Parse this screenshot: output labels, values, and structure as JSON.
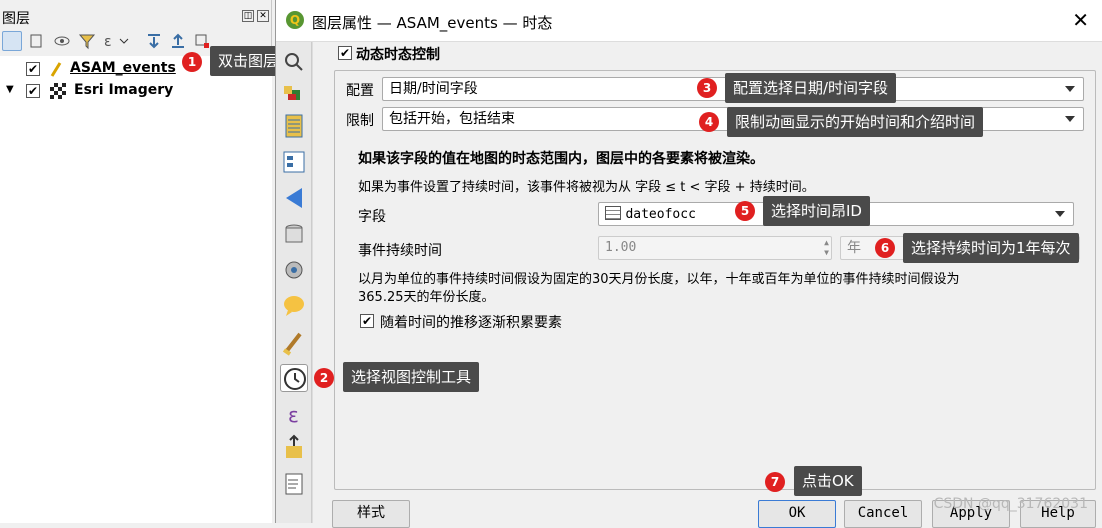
{
  "layers_panel": {
    "title": "图层",
    "layers": [
      {
        "name": "ASAM_events",
        "checked": true
      },
      {
        "name": "Esri Imagery",
        "checked": true
      }
    ]
  },
  "dialog": {
    "title": "图层属性 — ASAM_events — 时态",
    "enable_label": "动态时态控制",
    "config_label": "配置",
    "config_value": "日期/时间字段",
    "limit_label": "限制",
    "limit_value": "包括开始，包括结束",
    "info_bold": "如果该字段的值在地图的时态范围内，图层中的各要素将被渲染。",
    "info_text": "如果为事件设置了持续时间，该事件将被视为从 字段 ≤ t < 字段 + 持续时间。",
    "field_label": "字段",
    "field_value": "dateofocc",
    "duration_label": "事件持续时间",
    "duration_value": "1.00",
    "duration_unit": "年",
    "note_line1": "以月为单位的事件持续时间假设为固定的30天月份长度，以年，十年或百年为单位的事件持续时间假设为",
    "note_line2": "365.25天的年份长度。",
    "accumulate_label": "随着时间的推移逐渐积累要素",
    "style_button": "样式",
    "ok_button": "OK",
    "cancel_button": "Cancel",
    "apply_button": "Apply",
    "help_button": "Help"
  },
  "annotations": [
    {
      "n": "1",
      "text": "双击图层打开图层属性"
    },
    {
      "n": "2",
      "text": "选择视图控制工具"
    },
    {
      "n": "3",
      "text": "配置选择日期/时间字段"
    },
    {
      "n": "4",
      "text": "限制动画显示的开始时间和介绍时间"
    },
    {
      "n": "5",
      "text": "选择时间昂ID"
    },
    {
      "n": "6",
      "text": "选择持续时间为1年每次"
    },
    {
      "n": "7",
      "text": "点击OK"
    }
  ],
  "watermark": "CSDN @qq_31762031",
  "colors": {
    "badge": "#e02020",
    "callout": "#4a4a4a",
    "qgis_green": "#589632"
  }
}
